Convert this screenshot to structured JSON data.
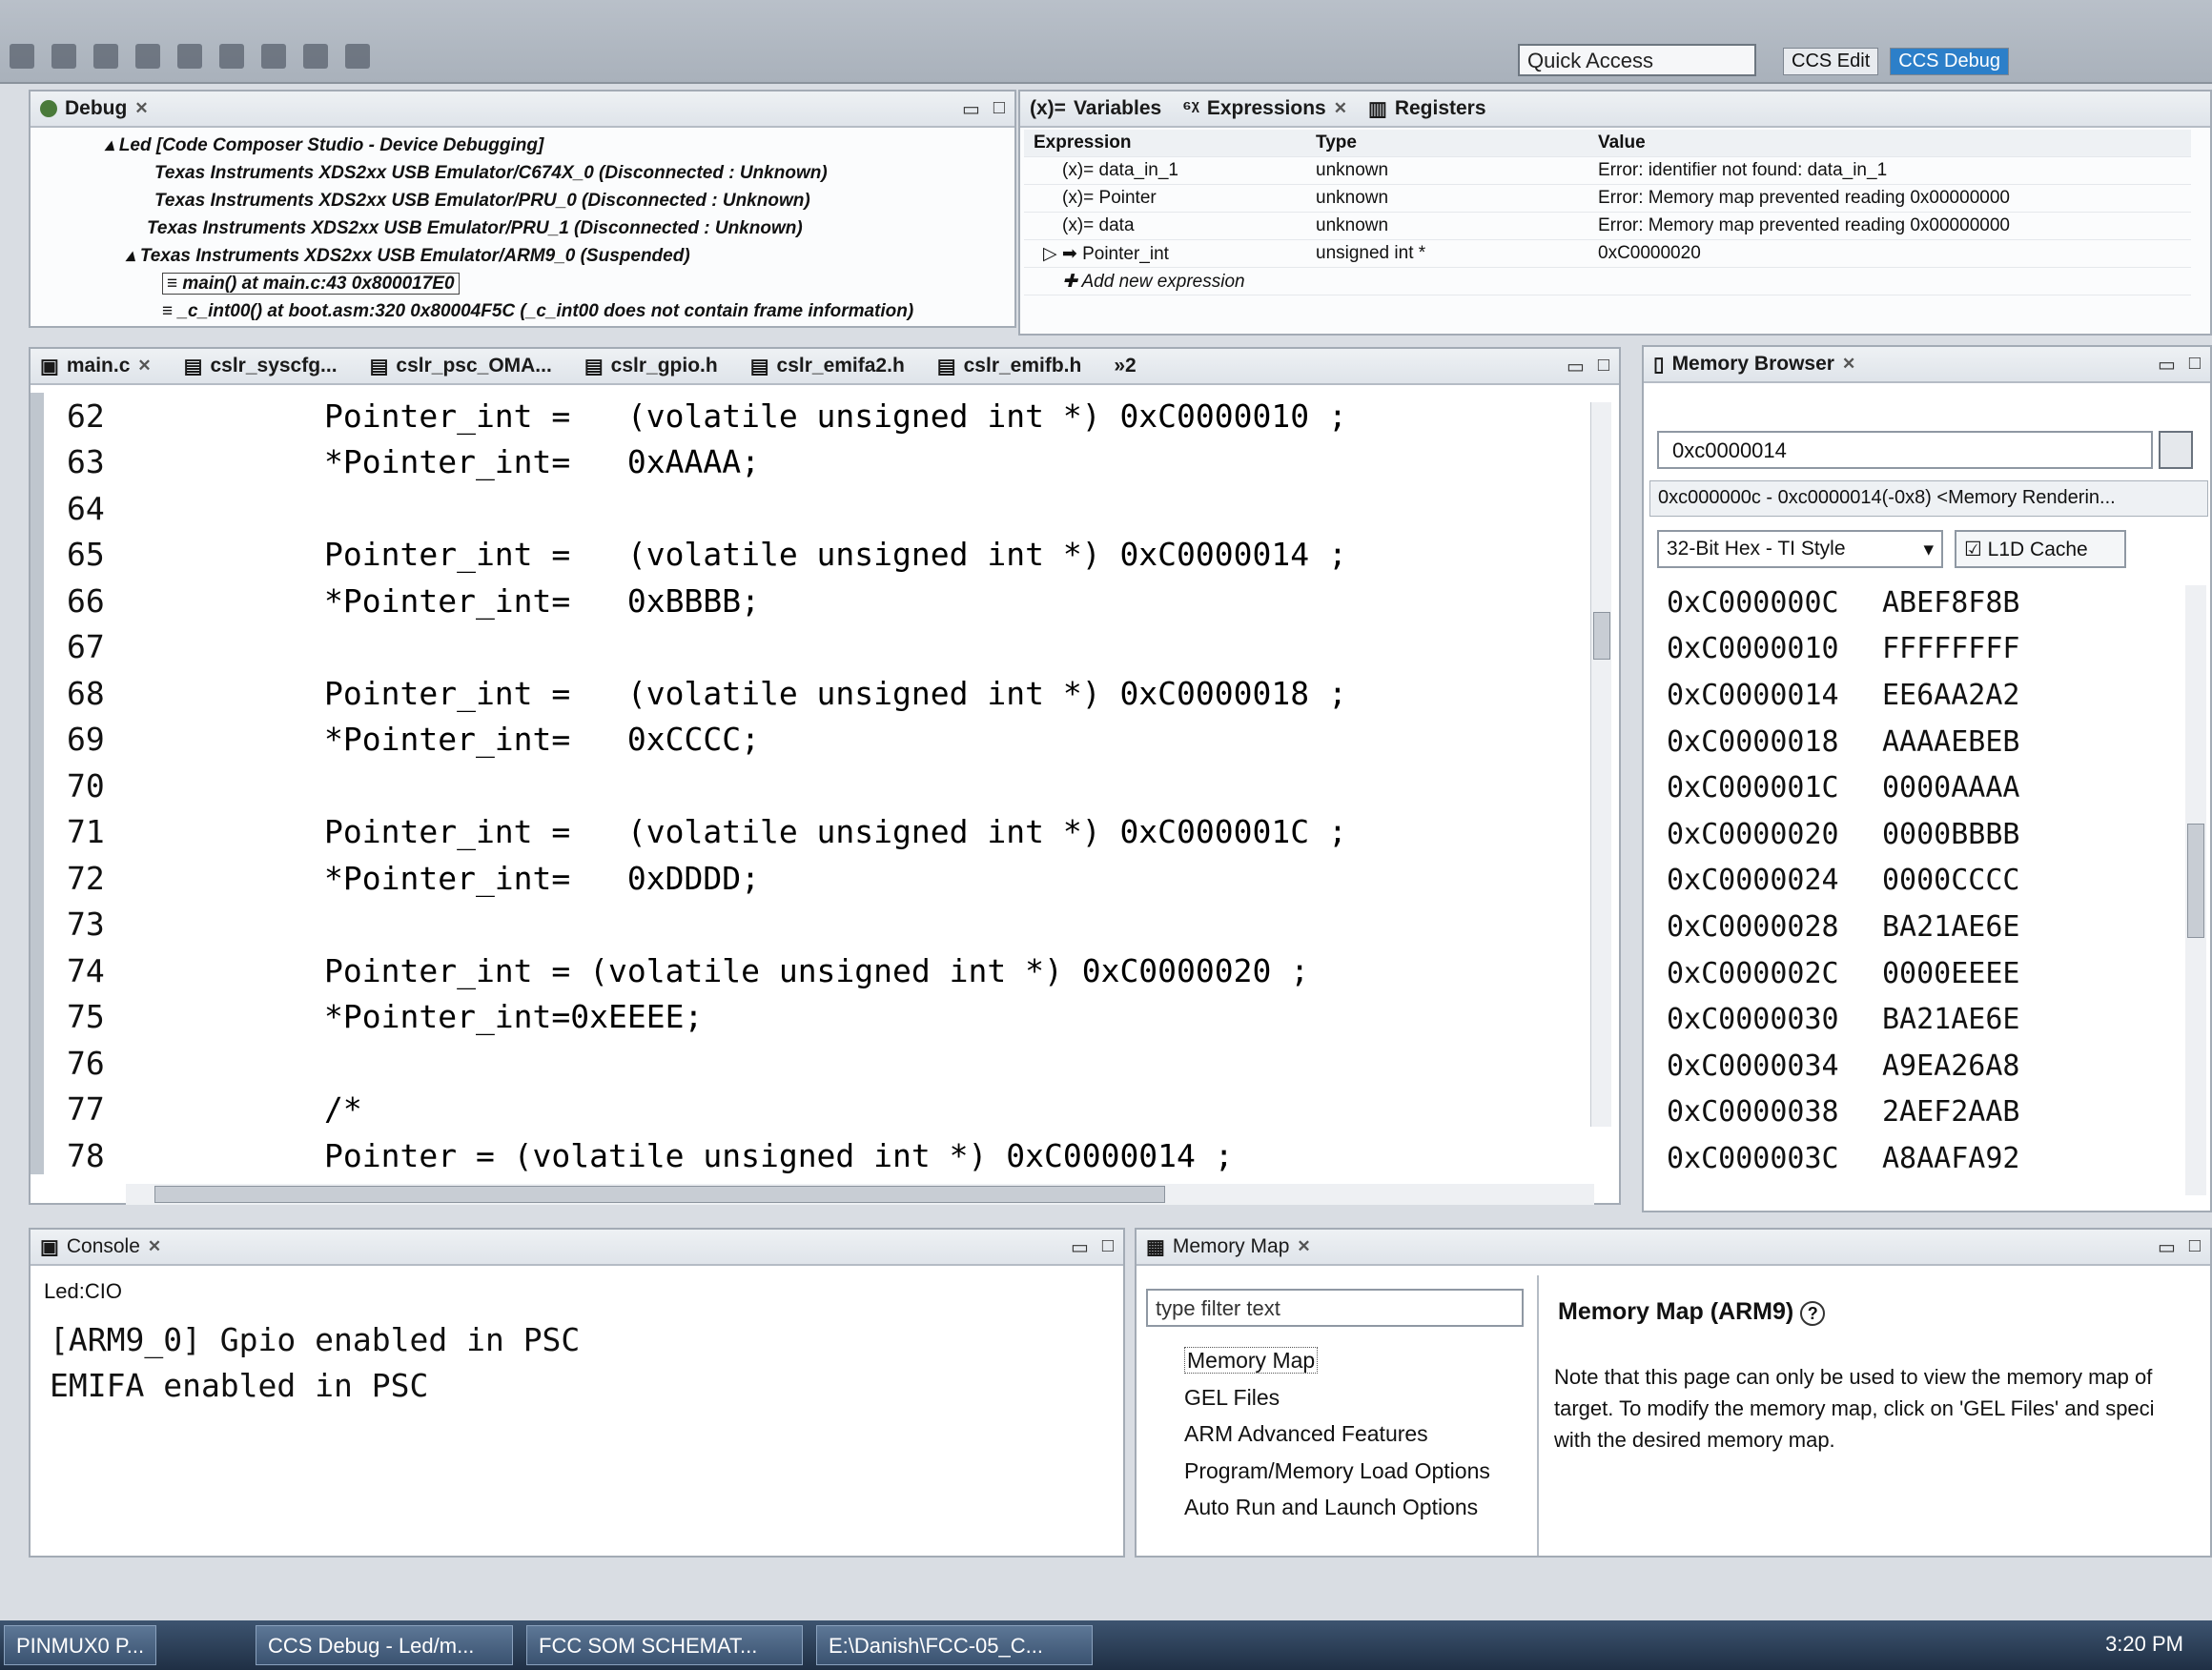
{
  "toolbar": {
    "quick_access": "Quick Access",
    "perspectives": [
      "CCS Edit",
      "CCS Debug"
    ]
  },
  "debug": {
    "tab_label": "Debug",
    "tree": [
      "Led [Code Composer Studio - Device Debugging]",
      "Texas Instruments XDS2xx USB Emulator/C674X_0 (Disconnected : Unknown)",
      "Texas Instruments XDS2xx USB Emulator/PRU_0 (Disconnected : Unknown)",
      "Texas Instruments XDS2xx USB Emulator/PRU_1 (Disconnected : Unknown)",
      "Texas Instruments XDS2xx USB Emulator/ARM9_0 (Suspended)",
      "main() at main.c:43 0x800017E0",
      "_c_int00() at boot.asm:320 0x80004F5C  (_c_int00 does not contain frame information)"
    ]
  },
  "expressions": {
    "tabs": [
      "Variables",
      "Expressions",
      "Registers"
    ],
    "headers": [
      "Expression",
      "Type",
      "Value"
    ],
    "rows": [
      {
        "expression": "data_in_1",
        "type": "unknown",
        "value": "Error: identifier not found: data_in_1"
      },
      {
        "expression": "Pointer",
        "type": "unknown",
        "value": "Error: Memory map prevented reading 0x00000000"
      },
      {
        "expression": "data",
        "type": "unknown",
        "value": "Error: Memory map prevented reading 0x00000000"
      },
      {
        "expression": "Pointer_int",
        "type": "unsigned int *",
        "value": "0xC0000020"
      }
    ],
    "add_new": "Add new expression"
  },
  "editor": {
    "tabs": [
      "main.c",
      "cslr_syscfg...",
      "cslr_psc_OMA...",
      "cslr_gpio.h",
      "cslr_emifa2.h",
      "cslr_emifb.h",
      "»2"
    ],
    "lines": [
      {
        "n": "62",
        "code": "Pointer_int =   (volatile unsigned int *) 0xC0000010 ;"
      },
      {
        "n": "63",
        "code": "*Pointer_int=   0xAAAA;"
      },
      {
        "n": "64",
        "code": ""
      },
      {
        "n": "65",
        "code": "Pointer_int =   (volatile unsigned int *) 0xC0000014 ;"
      },
      {
        "n": "66",
        "code": "*Pointer_int=   0xBBBB;"
      },
      {
        "n": "67",
        "code": ""
      },
      {
        "n": "68",
        "code": "Pointer_int =   (volatile unsigned int *) 0xC0000018 ;"
      },
      {
        "n": "69",
        "code": "*Pointer_int=   0xCCCC;"
      },
      {
        "n": "70",
        "code": ""
      },
      {
        "n": "71",
        "code": "Pointer_int =   (volatile unsigned int *) 0xC000001C ;"
      },
      {
        "n": "72",
        "code": "*Pointer_int=   0xDDDD;"
      },
      {
        "n": "73",
        "code": ""
      },
      {
        "n": "74",
        "code": "Pointer_int = (volatile unsigned int *) 0xC0000020 ;"
      },
      {
        "n": "75",
        "code": "*Pointer_int=0xEEEE;"
      },
      {
        "n": "76",
        "code": ""
      },
      {
        "n": "77",
        "code": "/*"
      },
      {
        "n": "78",
        "code": "Pointer = (volatile unsigned int *) 0xC0000014 ;"
      }
    ]
  },
  "memory_browser": {
    "tab_label": "Memory Browser",
    "address": "0xc0000014",
    "subtab": "0xc000000c - 0xc0000014(-0x8) <Memory Renderin...",
    "format": "32-Bit Hex - TI Style",
    "cache": "L1D Cache",
    "rows": [
      {
        "addr": "0xC000000C",
        "val": "ABEF8F8B"
      },
      {
        "addr": "0xC0000010",
        "val": "FFFFFFFF"
      },
      {
        "addr": "0xC0000014",
        "val": "EE6AA2A2"
      },
      {
        "addr": "0xC0000018",
        "val": "AAAAEBEB"
      },
      {
        "addr": "0xC000001C",
        "val": "0000AAAA"
      },
      {
        "addr": "0xC0000020",
        "val": "0000BBBB"
      },
      {
        "addr": "0xC0000024",
        "val": "0000CCCC"
      },
      {
        "addr": "0xC0000028",
        "val": "BA21AE6E"
      },
      {
        "addr": "0xC000002C",
        "val": "0000EEEE"
      },
      {
        "addr": "0xC0000030",
        "val": "BA21AE6E"
      },
      {
        "addr": "0xC0000034",
        "val": "A9EA26A8"
      },
      {
        "addr": "0xC0000038",
        "val": "2AEF2AAB"
      },
      {
        "addr": "0xC000003C",
        "val": "A8AAFA92"
      }
    ]
  },
  "console": {
    "tab_label": "Console",
    "name": "Led:CIO",
    "output": [
      "[ARM9_0] Gpio enabled in PSC",
      "EMIFA enabled in PSC"
    ]
  },
  "memory_map": {
    "tab_label": "Memory Map",
    "filter_placeholder": "type filter text",
    "items": [
      "Memory Map",
      "GEL Files",
      "ARM Advanced Features",
      "Program/Memory Load Options",
      "Auto Run and Launch Options"
    ],
    "title": "Memory Map (ARM9)",
    "desc_1": "Note that this page can only be used to view the memory map of",
    "desc_2": "target.  To modify the memory map, click on 'GEL Files' and speci",
    "desc_3": "with the desired memory map."
  },
  "taskbar": {
    "items": [
      "PINMUX0 P...",
      "CCS Debug - Led/m...",
      "FCC SOM SCHEMAT...",
      "E:\\Danish\\FCC-05_C..."
    ],
    "clock": "3:20 PM"
  }
}
